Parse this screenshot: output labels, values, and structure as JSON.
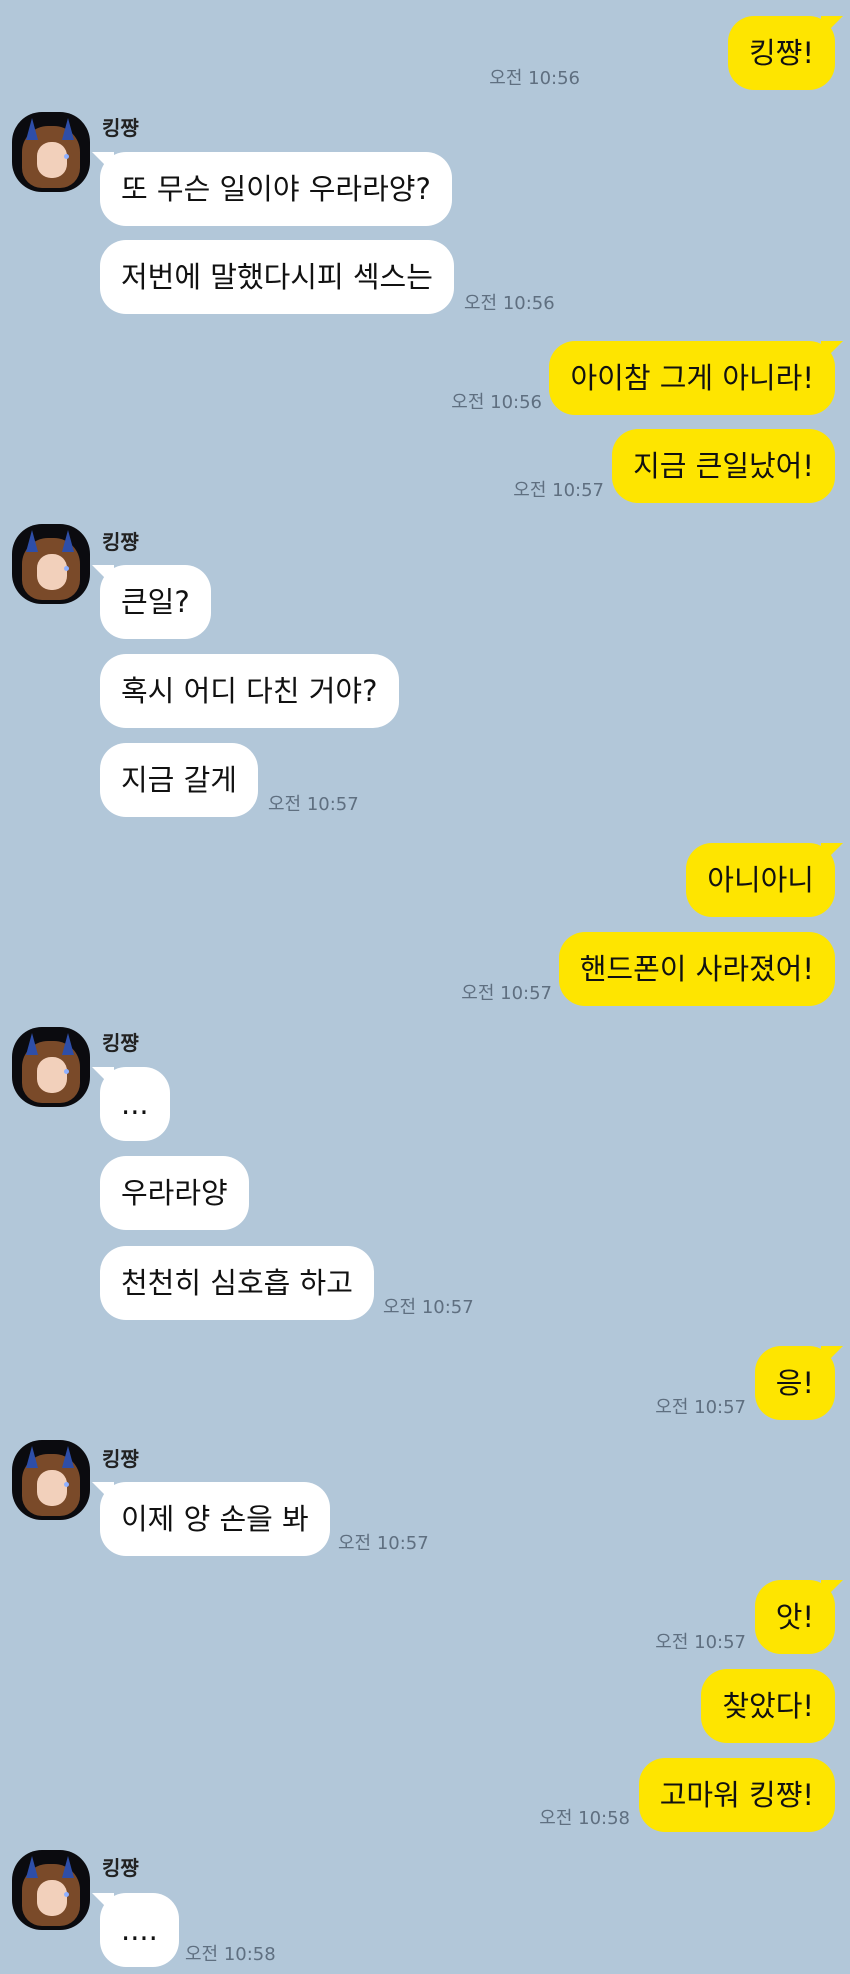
{
  "contact_name": "킹쨩",
  "messages": [
    {
      "text": "킹쨩!",
      "time": "오전 10:56"
    },
    {
      "text": "또 무슨 일이야 우라라양?"
    },
    {
      "text": "저번에 말했다시피 섹스는",
      "time": "오전 10:56"
    },
    {
      "text": "아이참 그게 아니라!",
      "time": "오전 10:56"
    },
    {
      "text": "지금 큰일났어!",
      "time": "오전 10:57"
    },
    {
      "text": "큰일?"
    },
    {
      "text": "혹시 어디 다친 거야?"
    },
    {
      "text": "지금 갈게",
      "time": "오전 10:57"
    },
    {
      "text": "아니아니"
    },
    {
      "text": "핸드폰이 사라졌어!",
      "time": "오전 10:57"
    },
    {
      "text": "..."
    },
    {
      "text": "우라라양"
    },
    {
      "text": "천천히 심호흡 하고",
      "time": "오전 10:57"
    },
    {
      "text": "응!",
      "time": "오전 10:57"
    },
    {
      "text": "이제 양 손을 봐",
      "time": "오전 10:57"
    },
    {
      "text": "앗!",
      "time": "오전 10:57"
    },
    {
      "text": "찾았다!"
    },
    {
      "text": "고마워 킹쨩!",
      "time": "오전 10:58"
    },
    {
      "text": "....",
      "time": "오전 10:58"
    }
  ],
  "colors": {
    "background": "#b2c7d9",
    "my_bubble": "#fee500",
    "other_bubble": "#ffffff"
  }
}
